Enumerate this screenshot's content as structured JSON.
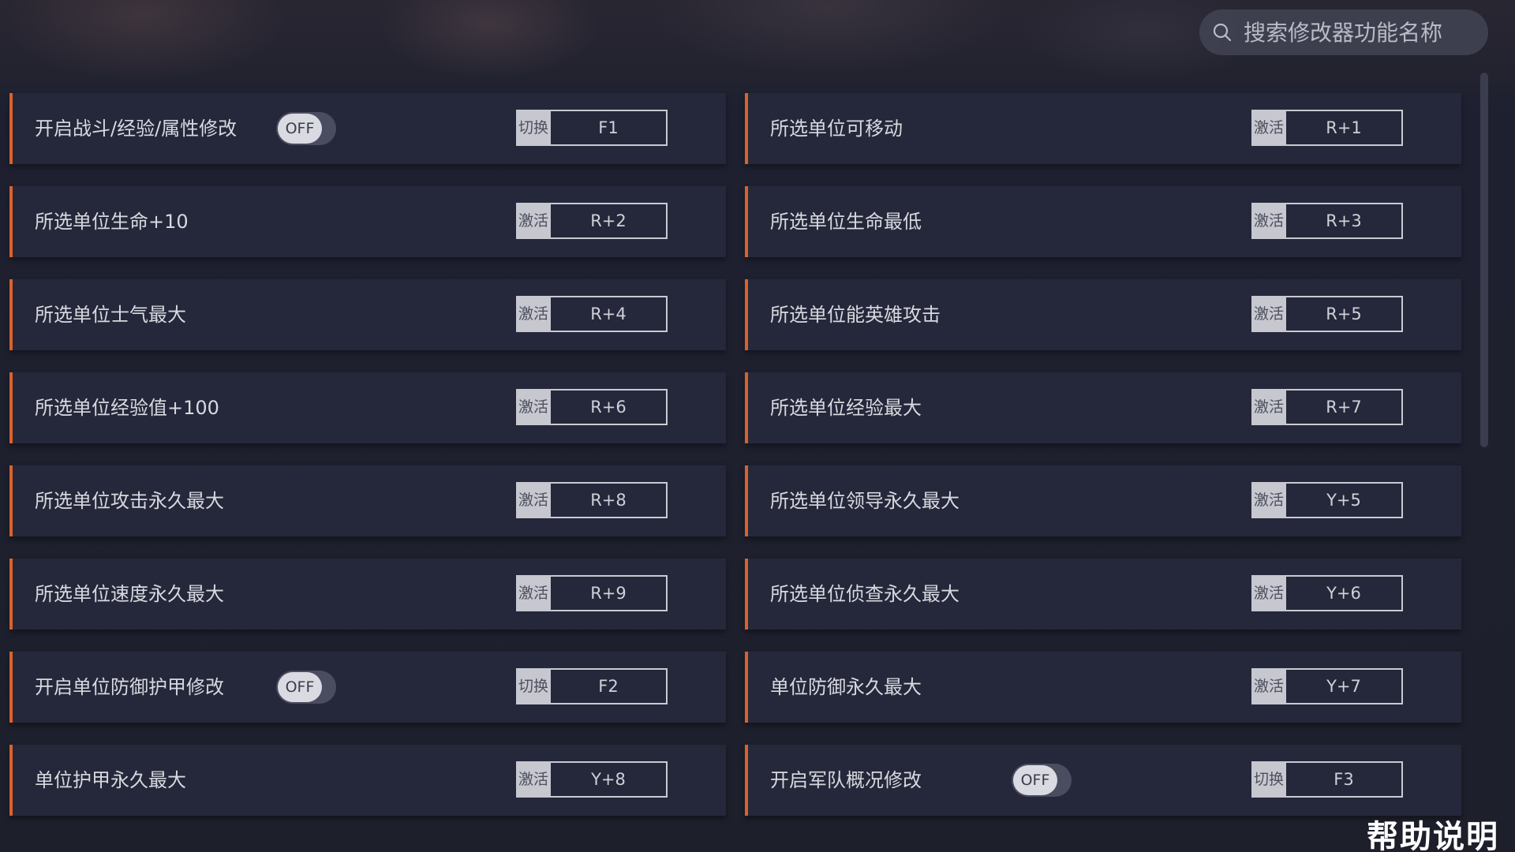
{
  "search": {
    "placeholder": "搜索修改器功能名称"
  },
  "items": [
    {
      "label": "开启战斗/经验/属性修改",
      "toggle": "OFF",
      "action": "切换",
      "key": "F1"
    },
    {
      "label": "所选单位可移动",
      "action": "激活",
      "key": "R+1"
    },
    {
      "label": "所选单位生命+10",
      "action": "激活",
      "key": "R+2"
    },
    {
      "label": "所选单位生命最低",
      "action": "激活",
      "key": "R+3"
    },
    {
      "label": "所选单位士气最大",
      "action": "激活",
      "key": "R+4"
    },
    {
      "label": "所选单位能英雄攻击",
      "action": "激活",
      "key": "R+5"
    },
    {
      "label": "所选单位经验值+100",
      "action": "激活",
      "key": "R+6"
    },
    {
      "label": "所选单位经验最大",
      "action": "激活",
      "key": "R+7"
    },
    {
      "label": "所选单位攻击永久最大",
      "action": "激活",
      "key": "R+8"
    },
    {
      "label": "所选单位领导永久最大",
      "action": "激活",
      "key": "Y+5"
    },
    {
      "label": "所选单位速度永久最大",
      "action": "激活",
      "key": "R+9"
    },
    {
      "label": "所选单位侦查永久最大",
      "action": "激活",
      "key": "Y+6"
    },
    {
      "label": "开启单位防御护甲修改",
      "toggle": "OFF",
      "action": "切换",
      "key": "F2"
    },
    {
      "label": "单位防御永久最大",
      "action": "激活",
      "key": "Y+7"
    },
    {
      "label": "单位护甲永久最大",
      "action": "激活",
      "key": "Y+8"
    },
    {
      "label": "开启军队概况修改",
      "toggle": "OFF",
      "action": "切换",
      "key": "F3"
    }
  ],
  "footer": {
    "help": "帮助说明"
  },
  "colors": {
    "accent": "#d9622b",
    "card": "#25283a",
    "background": "#1d1f2b"
  },
  "icons": {
    "search": "search-icon"
  }
}
